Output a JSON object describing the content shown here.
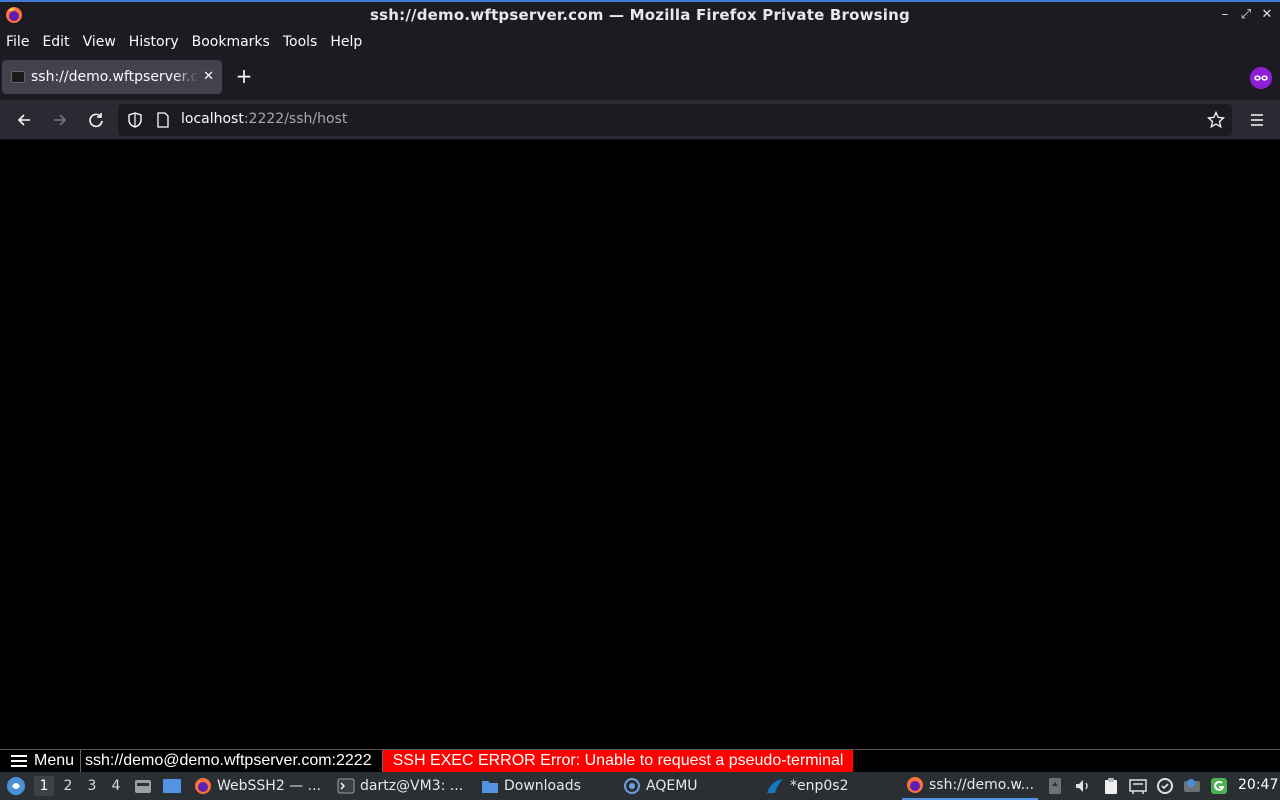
{
  "window": {
    "title": "ssh://demo.wftpserver.com — Mozilla Firefox Private Browsing"
  },
  "menubar": {
    "items": [
      "File",
      "Edit",
      "View",
      "History",
      "Bookmarks",
      "Tools",
      "Help"
    ]
  },
  "tabs": [
    {
      "title": "ssh://demo.wftpserver.com",
      "active": true
    }
  ],
  "navbar": {
    "url_host": "localhost",
    "url_rest": ":2222/ssh/host"
  },
  "page_status": {
    "menu_label": "Menu",
    "host": "ssh://demo@demo.wftpserver.com:2222",
    "error": "SSH EXEC ERROR Error: Unable to request a pseudo-terminal",
    "error_color": "#ff0000"
  },
  "taskbar": {
    "workspaces": [
      "1",
      "2",
      "3",
      "4"
    ],
    "active_workspace": "1",
    "tasks": [
      {
        "label": "WebSSH2 — ...",
        "icon": "firefox-icon"
      },
      {
        "label": "dartz@VM3: ...",
        "icon": "terminal-icon"
      },
      {
        "label": "Downloads",
        "icon": "folder-icon"
      },
      {
        "label": "AQEMU",
        "icon": "aqemu-icon"
      },
      {
        "label": "*enp0s2",
        "icon": "wireshark-icon"
      },
      {
        "label": "ssh://demo.w...",
        "icon": "firefox-icon",
        "active": true
      }
    ],
    "clock": "20:47"
  },
  "colors": {
    "accent": "#3d7bd4",
    "private_browsing": "#8f1ed6",
    "toolbar_bg": "#2b2a33",
    "frame_bg": "#1c1b22"
  }
}
